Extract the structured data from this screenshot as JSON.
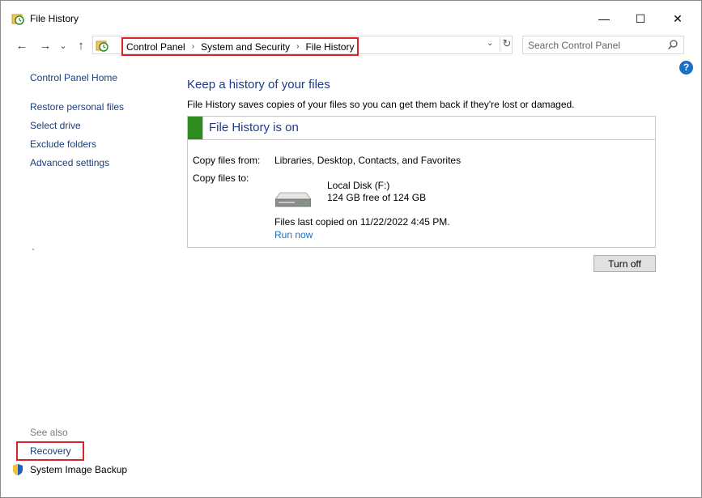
{
  "window": {
    "title": "File History",
    "minimize_glyph": "—",
    "maximize_glyph": "☐",
    "close_glyph": "✕"
  },
  "nav": {
    "back_glyph": "←",
    "forward_glyph": "→",
    "recent_glyph": "⌄",
    "up_glyph": "↑"
  },
  "address": {
    "breadcrumbs": [
      "Control Panel",
      "System and Security",
      "File History"
    ],
    "separator": "›",
    "dropdown_glyph": "⌄",
    "refresh_glyph": "↻"
  },
  "search": {
    "placeholder": "Search Control Panel",
    "value": ""
  },
  "help": {
    "glyph": "?"
  },
  "sidebar": {
    "home": "Control Panel Home",
    "items": [
      {
        "label": "Restore personal files"
      },
      {
        "label": "Select drive"
      },
      {
        "label": "Exclude folders"
      },
      {
        "label": "Advanced settings"
      }
    ],
    "mark": "`",
    "see_also_label": "See also",
    "see_also": [
      {
        "label": "Recovery"
      },
      {
        "label": "System Image Backup"
      }
    ]
  },
  "main": {
    "heading": "Keep a history of your files",
    "description": "File History saves copies of your files so you can get them back if they're lost or damaged.",
    "status": "File History is on",
    "copy_from_label": "Copy files from:",
    "copy_from_value": "Libraries, Desktop, Contacts, and Favorites",
    "copy_to_label": "Copy files to:",
    "drive_name": "Local Disk (F:)",
    "drive_free": "124 GB free of 124 GB",
    "last_copied": "Files last copied on 11/22/2022 4:45 PM.",
    "run_now": "Run now",
    "turn_off": "Turn off"
  },
  "colors": {
    "accent_blue": "#1e3a8a",
    "link_blue": "#1a6fc4",
    "status_green": "#2e8b1e",
    "highlight_red": "#d9252a"
  }
}
